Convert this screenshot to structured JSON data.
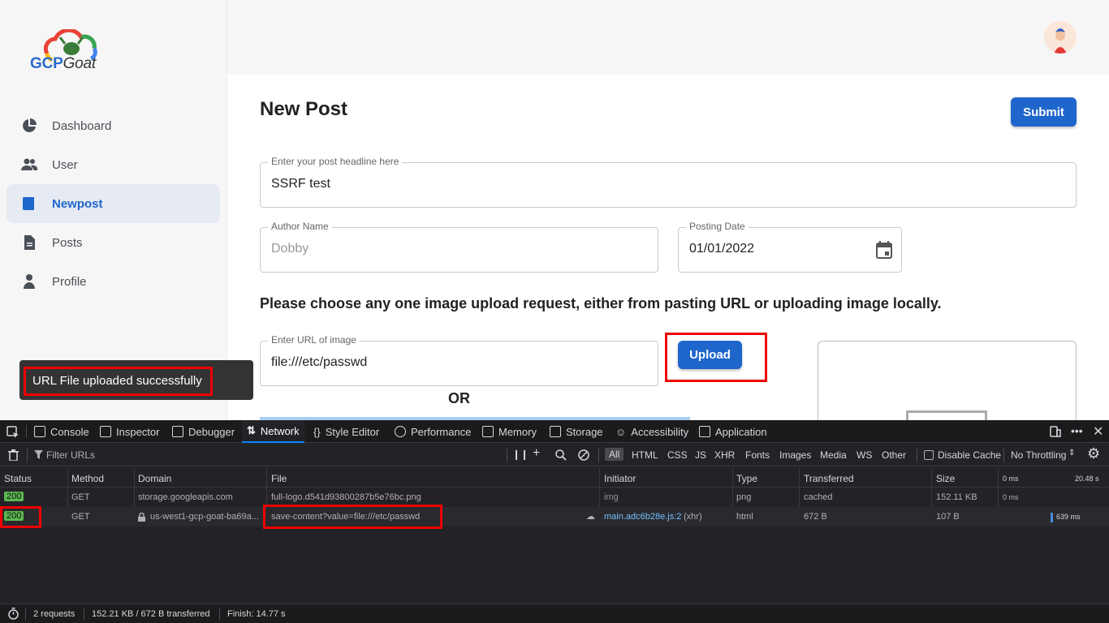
{
  "app": {
    "logo": {
      "text_main": "GCP",
      "text_italic": "Goat"
    },
    "sidebar": {
      "items": [
        {
          "label": "Dashboard",
          "icon": "pie-chart-icon"
        },
        {
          "label": "User",
          "icon": "users-icon"
        },
        {
          "label": "Newpost",
          "icon": "book-icon"
        },
        {
          "label": "Posts",
          "icon": "document-icon"
        },
        {
          "label": "Profile",
          "icon": "person-icon"
        }
      ],
      "active": "Newpost"
    },
    "page_title": "New Post",
    "submit_label": "Submit",
    "headline": {
      "label": "Enter your post headline here",
      "value": "SSRF test"
    },
    "author": {
      "label": "Author Name",
      "value": "Dobby"
    },
    "date": {
      "label": "Posting Date",
      "value": "01/01/2022"
    },
    "instructions": "Please choose any one image upload request, either from pasting URL or uploading image locally.",
    "url_field": {
      "label": "Enter URL of image",
      "value": "file:///etc/passwd"
    },
    "upload_label": "Upload",
    "or_text": "OR",
    "toast": "URL File uploaded successfully",
    "accent_color": "#1f66cc"
  },
  "devtools": {
    "tabs": [
      "Console",
      "Inspector",
      "Debugger",
      "Network",
      "Style Editor",
      "Performance",
      "Memory",
      "Storage",
      "Accessibility",
      "Application"
    ],
    "active_tab": "Network",
    "filter_placeholder": "Filter URLs",
    "type_filters": [
      "All",
      "HTML",
      "CSS",
      "JS",
      "XHR",
      "Fonts",
      "Images",
      "Media",
      "WS",
      "Other"
    ],
    "disable_cache": "Disable Cache",
    "throttling": "No Throttling",
    "columns": [
      "Status",
      "Method",
      "Domain",
      "File",
      "Initiator",
      "Type",
      "Transferred",
      "Size",
      "0 ms",
      "20.48 s"
    ],
    "rows": [
      {
        "status": "200",
        "method": "GET",
        "domain": "storage.googleapis.com",
        "file": "full-logo.d541d93800287b5e76bc.png",
        "initiator": "img",
        "type": "png",
        "transferred": "cached",
        "size": "152.11 KB",
        "timing": "0 ms"
      },
      {
        "status": "200",
        "method": "GET",
        "domain": "us-west1-gcp-goat-ba69a...",
        "file": "save-content?value=file:///etc/passwd",
        "initiator": "main.adc6b28e.js:2",
        "initiator_suffix": "(xhr)",
        "type": "html",
        "transferred": "672 B",
        "size": "107 B",
        "timing": "639 ms"
      }
    ],
    "status_bar": {
      "requests": "2 requests",
      "transferred": "152.21 KB / 672 B transferred",
      "finish": "Finish: 14.77 s"
    }
  }
}
